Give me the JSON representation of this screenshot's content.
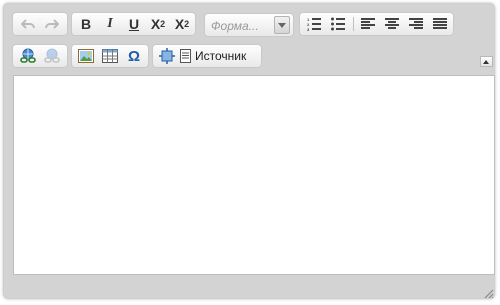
{
  "toolbar": {
    "undo": {
      "icon": "undo-arrow-icon"
    },
    "redo": {
      "icon": "redo-arrow-icon"
    },
    "bold": {
      "label": "B"
    },
    "italic": {
      "label": "I"
    },
    "underline": {
      "label": "U"
    },
    "subscript": {
      "label": "X",
      "sub": "2"
    },
    "superscript": {
      "label": "X",
      "sup": "2"
    },
    "format_combo": {
      "placeholder": "Форма..."
    },
    "source": {
      "label": "Источник"
    }
  },
  "colors": {
    "frame_bg": "#d3d3d3",
    "toolbar_bg_top": "#ffffff",
    "toolbar_bg_bottom": "#e9e9e9",
    "accent_blue": "#1f5fa8"
  }
}
